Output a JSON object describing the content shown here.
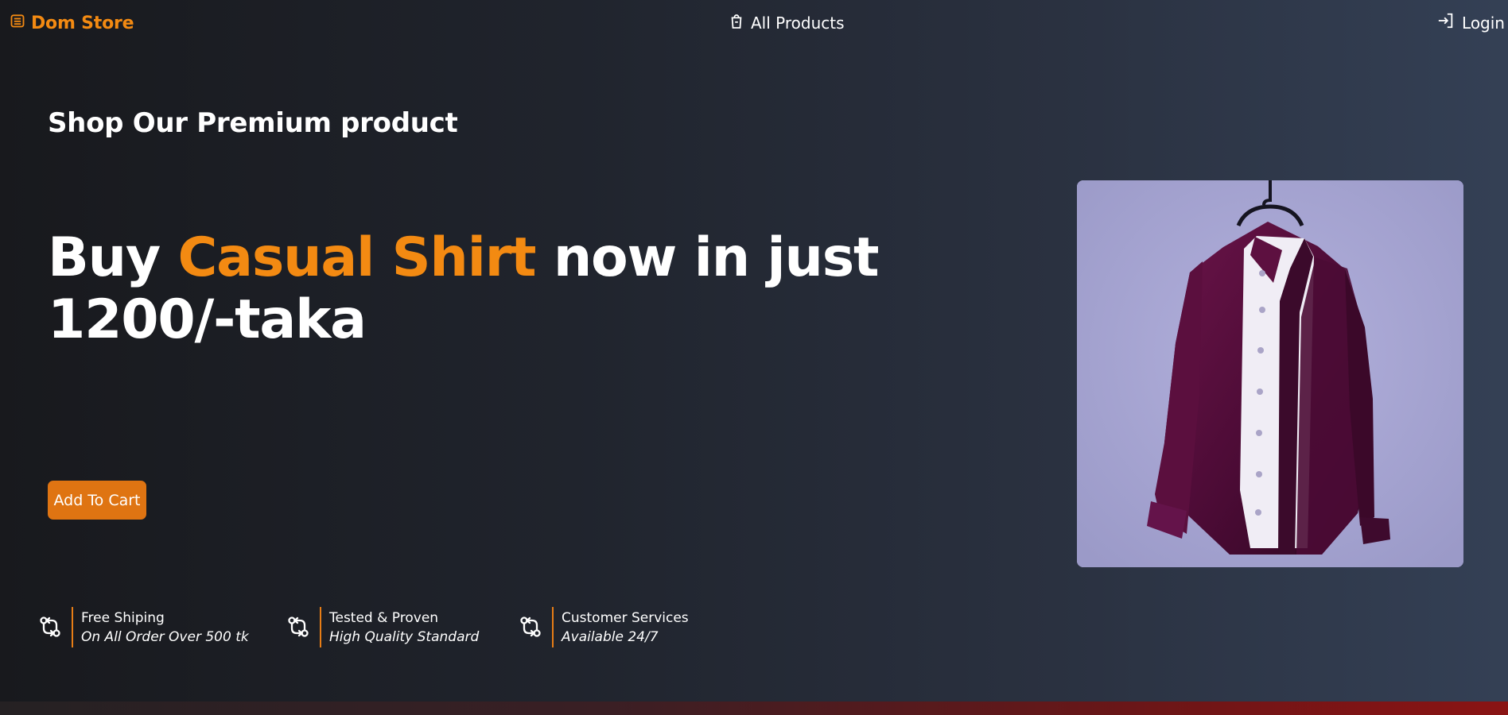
{
  "nav": {
    "brand": "Dom Store",
    "products_link": "All Products",
    "login_link": "Login"
  },
  "hero": {
    "eyebrow": "Shop Our Premium product",
    "headline_before": "Buy ",
    "headline_accent": "Casual Shirt",
    "headline_after": " now in just 1200/-taka",
    "cta_label": "Add To Cart",
    "image_alt": "Purple casual shirt on hanger"
  },
  "features": [
    {
      "title": "Free Shiping",
      "subtitle": "On All Order Over 500 tk",
      "icon": "git-compare-icon"
    },
    {
      "title": "Tested & Proven",
      "subtitle": "High Quality Standard",
      "icon": "git-compare-icon"
    },
    {
      "title": "Customer Services",
      "subtitle": "Available 24/7",
      "icon": "git-compare-icon"
    }
  ],
  "colors": {
    "accent": "#F38A12",
    "button": "#DF7412",
    "background_start": "#18191D",
    "background_end": "#344055"
  }
}
